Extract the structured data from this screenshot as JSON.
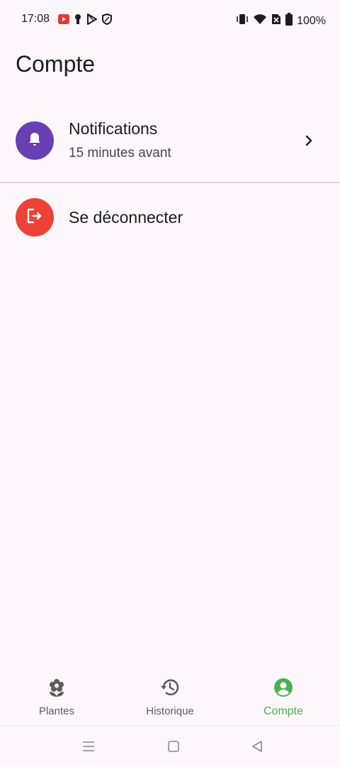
{
  "status_bar": {
    "time": "17:08",
    "battery_percent": "100%",
    "icons_left": [
      "youtube-icon",
      "keyhole-icon",
      "play-store-icon",
      "shield-icon"
    ],
    "icons_right": [
      "vibrate-icon",
      "wifi-icon",
      "no-sim-icon",
      "battery-icon"
    ]
  },
  "header": {
    "title": "Compte"
  },
  "list": {
    "notifications": {
      "title": "Notifications",
      "subtitle": "15 minutes avant",
      "icon": "bell-icon",
      "icon_bg": "#6a3fb6"
    },
    "logout": {
      "title": "Se déconnecter",
      "icon": "logout-icon",
      "icon_bg": "#ef4236"
    }
  },
  "bottom_nav": {
    "items": [
      {
        "label": "Plantes",
        "icon": "flower-icon",
        "active": false
      },
      {
        "label": "Historique",
        "icon": "history-icon",
        "active": false
      },
      {
        "label": "Compte",
        "icon": "account-icon",
        "active": true
      }
    ],
    "active_color": "#4caf50"
  },
  "system_nav": [
    "menu-icon",
    "home-icon",
    "back-icon"
  ]
}
